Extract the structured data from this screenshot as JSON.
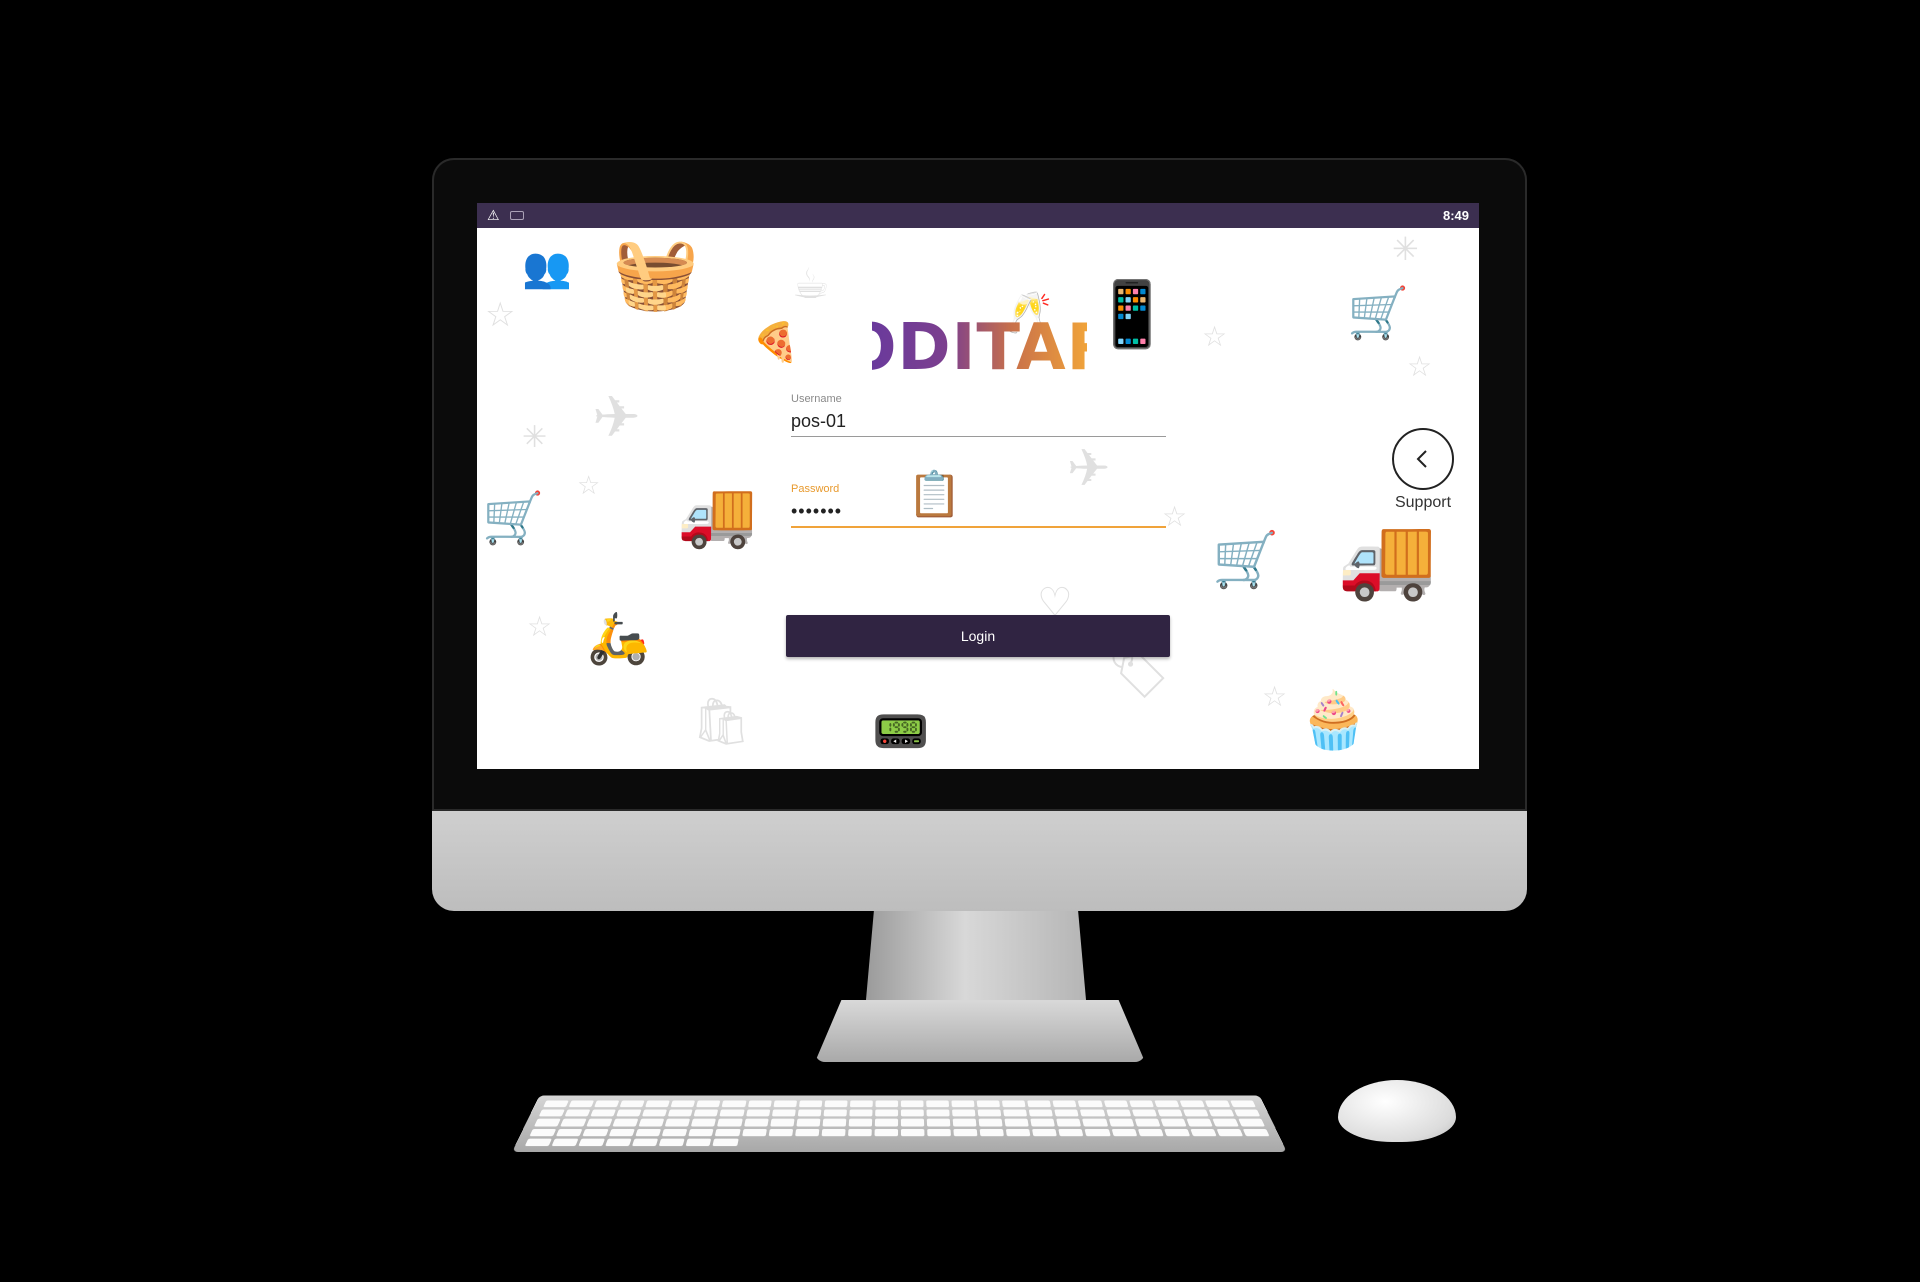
{
  "status_bar": {
    "warning_icon": "warning-icon",
    "keyboard_icon": "keyboard-icon",
    "time": "8:49"
  },
  "app": {
    "logo_text": "ODITAR"
  },
  "login_form": {
    "username_label": "Username",
    "username_value": "pos-01",
    "password_label": "Password",
    "password_value": "•••••••",
    "login_button_label": "Login"
  },
  "support": {
    "label": "Support",
    "icon": "chevron-left-icon"
  },
  "colors": {
    "status_bar": "#3c2f50",
    "button": "#302442",
    "accent": "#f0a33a",
    "logo_start": "#6a3a9c",
    "logo_end": "#f0a33a"
  }
}
